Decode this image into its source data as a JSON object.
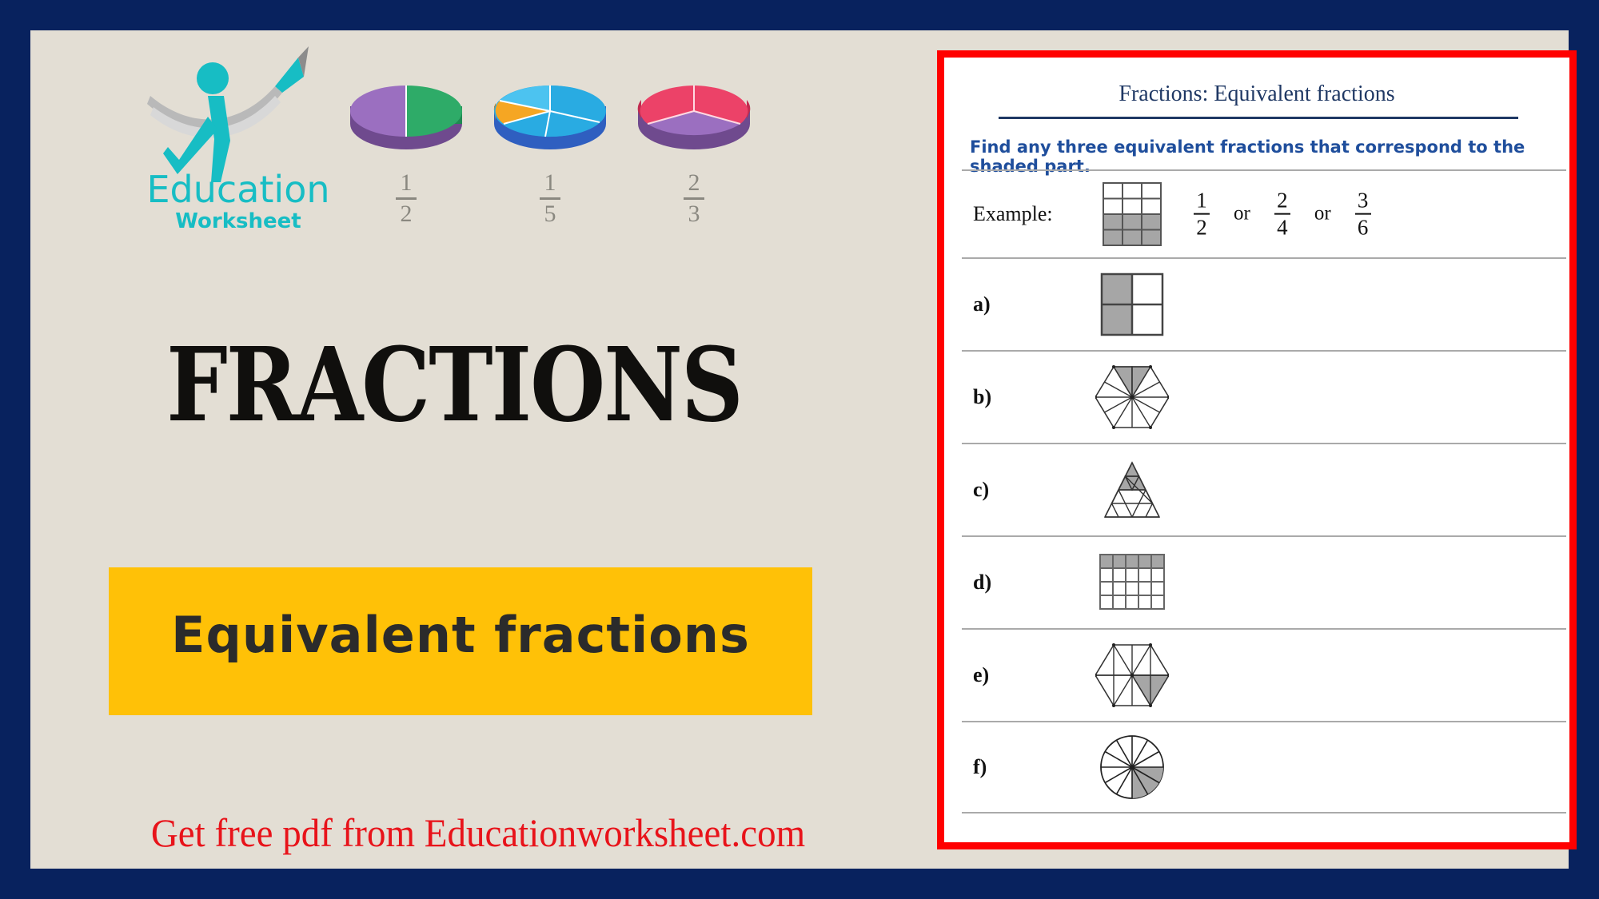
{
  "page": {
    "border_color": "#08225e",
    "background_color": "#e3ded4"
  },
  "logo": {
    "name_top": "Education",
    "name_bottom": "Worksheet",
    "color": "#17bdc4"
  },
  "pie_charts": [
    {
      "label_num": "1",
      "label_den": "2",
      "slices": 2,
      "colors": [
        "#8e5fb0",
        "#2eab68"
      ]
    },
    {
      "label_num": "1",
      "label_den": "5",
      "slices": 5,
      "colors": [
        "#29abe2",
        "#f5a623"
      ]
    },
    {
      "label_num": "2",
      "label_den": "3",
      "slices": 3,
      "colors": [
        "#ec4268",
        "#8e5fb0"
      ]
    }
  ],
  "title": "FRACTIONS",
  "banner": {
    "text": "Equivalent fractions",
    "background": "#ffc107",
    "text_color": "#2b2b2b"
  },
  "footer": {
    "text": "Get free pdf from Educationworksheet.com",
    "color": "#e8131a"
  },
  "worksheet": {
    "border_color": "#ff0000",
    "title": "Fractions: Equivalent fractions",
    "title_color": "#1f3864",
    "instruction": "Find any three equivalent fractions that correspond to the shaded part.",
    "instruction_color": "#1f4e9c",
    "shade_color": "#a6a6a6",
    "example": {
      "label": "Example:",
      "shape": "grid-3x4-bottom-2-rows-shaded",
      "answers": [
        {
          "num": "1",
          "den": "2"
        },
        {
          "num": "2",
          "den": "4"
        },
        {
          "num": "3",
          "den": "6"
        }
      ],
      "or_word": "or"
    },
    "questions": [
      {
        "label": "a)",
        "shape": "grid-2x2-left-column-shaded"
      },
      {
        "label": "b)",
        "shape": "hexagon-12-triangles-top-sector-shaded"
      },
      {
        "label": "c)",
        "shape": "triangle-16-parts-top-4-shaded"
      },
      {
        "label": "d)",
        "shape": "grid-5x4-top-row-shaded"
      },
      {
        "label": "e)",
        "shape": "hexagon-6-triangles-one-shaded"
      },
      {
        "label": "f)",
        "shape": "circle-12-sectors-3-shaded"
      }
    ]
  }
}
